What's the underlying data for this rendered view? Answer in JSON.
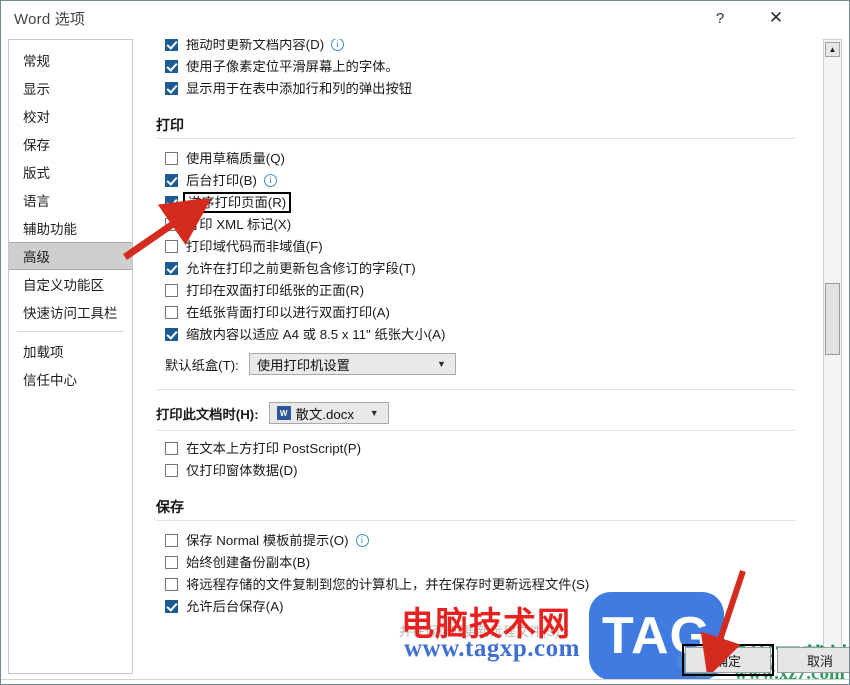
{
  "window": {
    "title": "Word 选项",
    "help_label": "?",
    "close_label": "✕"
  },
  "sidebar": {
    "items": [
      {
        "label": "常规",
        "selected": false
      },
      {
        "label": "显示",
        "selected": false
      },
      {
        "label": "校对",
        "selected": false
      },
      {
        "label": "保存",
        "selected": false
      },
      {
        "label": "版式",
        "selected": false
      },
      {
        "label": "语言",
        "selected": false
      },
      {
        "label": "辅助功能",
        "selected": false
      },
      {
        "label": "高级",
        "selected": true
      },
      {
        "label": "自定义功能区",
        "selected": false
      },
      {
        "label": "快速访问工具栏",
        "selected": false
      },
      {
        "label": "加载项",
        "selected": false
      },
      {
        "label": "信任中心",
        "selected": false
      }
    ]
  },
  "main": {
    "top_options": [
      {
        "label": "拖动时更新文档内容(D)",
        "checked": true,
        "info": true
      },
      {
        "label": "使用子像素定位平滑屏幕上的字体。",
        "checked": true,
        "info": false
      },
      {
        "label": "显示用于在表中添加行和列的弹出按钮",
        "checked": true,
        "info": false
      }
    ],
    "print_section": {
      "header": "打印",
      "options": [
        {
          "label": "使用草稿质量(Q)",
          "checked": false,
          "info": false,
          "highlight": false
        },
        {
          "label": "后台打印(B)",
          "checked": true,
          "info": true,
          "highlight": false
        },
        {
          "label": "逆序打印页面(R)",
          "checked": true,
          "info": false,
          "highlight": true
        },
        {
          "label": "打印 XML 标记(X)",
          "checked": false,
          "info": false,
          "highlight": false
        },
        {
          "label": "打印域代码而非域值(F)",
          "checked": false,
          "info": false,
          "highlight": false
        },
        {
          "label": "允许在打印之前更新包含修订的字段(T)",
          "checked": true,
          "info": false,
          "highlight": false
        },
        {
          "label": "打印在双面打印纸张的正面(R)",
          "checked": false,
          "info": false,
          "highlight": false
        },
        {
          "label": "在纸张背面打印以进行双面打印(A)",
          "checked": false,
          "info": false,
          "highlight": false
        },
        {
          "label": "缩放内容以适应 A4 或 8.5 x 11\" 纸张大小(A)",
          "checked": true,
          "info": false,
          "highlight": false
        }
      ],
      "tray": {
        "label": "默认纸盒(T):",
        "value": "使用打印机设置",
        "arrow": "▼"
      }
    },
    "doc_section": {
      "label": "打印此文档时(H):",
      "value": "散文.docx",
      "arrow": "▼",
      "options": [
        {
          "label": "在文本上方打印 PostScript(P)",
          "checked": false,
          "info": false
        },
        {
          "label": "仅打印窗体数据(D)",
          "checked": false,
          "info": false
        }
      ]
    },
    "save_section": {
      "header": "保存",
      "options": [
        {
          "label": "保存 Normal 模板前提示(O)",
          "checked": false,
          "info": true
        },
        {
          "label": "始终创建备份副本(B)",
          "checked": false,
          "info": false
        },
        {
          "label": "将远程存储的文件复制到您的计算机上，并在保存时更新远程文件(S)",
          "checked": false,
          "info": false
        },
        {
          "label": "允许后台保存(A)",
          "checked": true,
          "info": false
        }
      ]
    }
  },
  "scrollbar": {
    "up_arrow": "▲",
    "down_arrow": "▼"
  },
  "footer": {
    "ok_label": "确定",
    "cancel_label": "取消"
  },
  "watermarks": {
    "cn_site": "电脑技术网",
    "url": "www.tagxp.com",
    "tag_logo": "TAG",
    "jg_site": "极光下载站",
    "xz_url": "www.xz7.com"
  },
  "colors": {
    "accent": "#1d5c93",
    "selected_nav": "#cfcfcf",
    "watermark_red": "#e8211e",
    "watermark_blue": "#3f6fd0",
    "tag_blue": "#3f7be0",
    "jg_green": "#1b9a5e",
    "highlight_box": "#000000",
    "arrow_red": "#d42b1e"
  }
}
